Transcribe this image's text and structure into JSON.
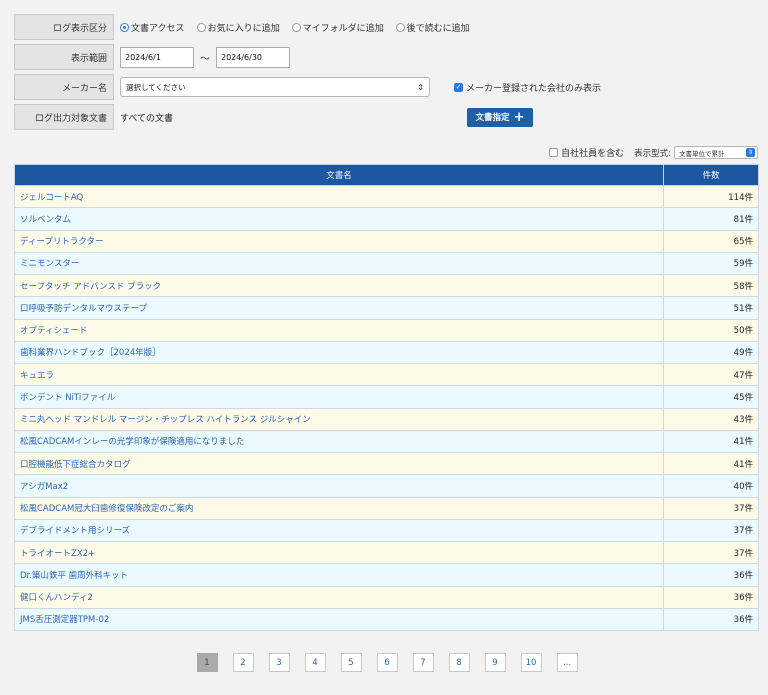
{
  "filters": {
    "log_type": {
      "label": "ログ表示区分",
      "options": [
        {
          "label": "文書アクセス",
          "selected": true
        },
        {
          "label": "お気に入りに追加",
          "selected": false
        },
        {
          "label": "マイフォルダに追加",
          "selected": false
        },
        {
          "label": "後で読むに追加",
          "selected": false
        }
      ]
    },
    "range": {
      "label": "表示範囲",
      "start": "2024/6/1",
      "sep": "〜",
      "end": "2024/6/30"
    },
    "maker": {
      "label": "メーカー名",
      "select_value": "選択してください",
      "checkbox_label": "メーカー登録された会社のみ表示",
      "checkbox_checked": true
    },
    "target": {
      "label": "ログ出力対象文書",
      "value": "すべての文書",
      "button_label": "文書指定"
    }
  },
  "options": {
    "include_employees_label": "自社社員を含む",
    "include_employees_checked": false,
    "view_type_label": "表示型式:",
    "view_type_value": "文書単位で累計"
  },
  "table": {
    "headers": {
      "name": "文書名",
      "count": "件数"
    },
    "rows": [
      {
        "name": "ジェルコートAQ",
        "count": "114件"
      },
      {
        "name": "ソルベンタム",
        "count": "81件"
      },
      {
        "name": "ディープリトラクター",
        "count": "65件"
      },
      {
        "name": "ミニモンスター",
        "count": "59件"
      },
      {
        "name": "セーフタッチ アドバンスド ブラック",
        "count": "58件"
      },
      {
        "name": "口呼吸予防デンタルマウステープ",
        "count": "51件"
      },
      {
        "name": "オプティシェード",
        "count": "50件"
      },
      {
        "name": "歯科業界ハンドブック［2024年版］",
        "count": "49件"
      },
      {
        "name": "キュエラ",
        "count": "47件"
      },
      {
        "name": "ボンデント NiTiファイル",
        "count": "45件"
      },
      {
        "name": "ミニ丸ヘッド マンドレル マージン・チップレス ハイトランス ジルシャイン",
        "count": "43件"
      },
      {
        "name": "松風CADCAMインレーの光学印象が保険適用になりました",
        "count": "41件"
      },
      {
        "name": "口腔機能低下症総合カタログ",
        "count": "41件"
      },
      {
        "name": "アシガMax2",
        "count": "40件"
      },
      {
        "name": "松風CADCAM冠大臼歯修復保険改定のご案内",
        "count": "37件"
      },
      {
        "name": "デブライドメント用シリーズ",
        "count": "37件"
      },
      {
        "name": "トライオートZX2+",
        "count": "37件"
      },
      {
        "name": "Dr.築山鉄平 歯周外科キット",
        "count": "36件"
      },
      {
        "name": "健口くんハンディ2",
        "count": "36件"
      },
      {
        "name": "JMS舌圧測定器TPM-02",
        "count": "36件"
      }
    ]
  },
  "pagination": {
    "pages": [
      "1",
      "2",
      "3",
      "4",
      "5",
      "6",
      "7",
      "8",
      "9",
      "10",
      "..."
    ],
    "current": "1"
  }
}
